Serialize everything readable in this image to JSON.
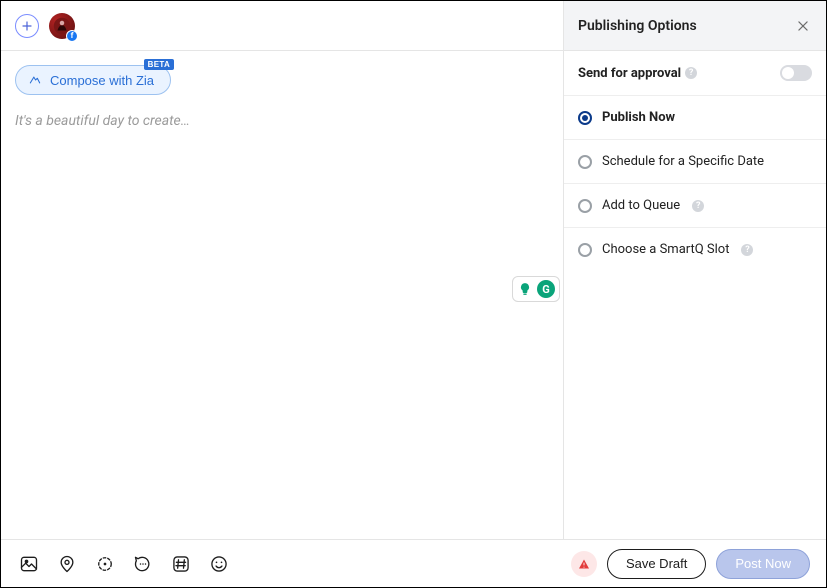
{
  "header": {},
  "compose": {
    "chip_label": "Compose with Zia",
    "chip_badge": "BETA",
    "placeholder": "It's a beautiful day to create…"
  },
  "float": {
    "g_letter": "G"
  },
  "panel": {
    "title": "Publishing Options",
    "approval_label": "Send for approval",
    "approval_on": false,
    "options": [
      {
        "label": "Publish Now",
        "checked": true,
        "info": false
      },
      {
        "label": "Schedule for a Specific Date",
        "checked": false,
        "info": false
      },
      {
        "label": "Add to Queue",
        "checked": false,
        "info": true
      },
      {
        "label": "Choose a SmartQ Slot",
        "checked": false,
        "info": true
      }
    ]
  },
  "footer": {
    "save_draft": "Save Draft",
    "post_now": "Post Now"
  }
}
